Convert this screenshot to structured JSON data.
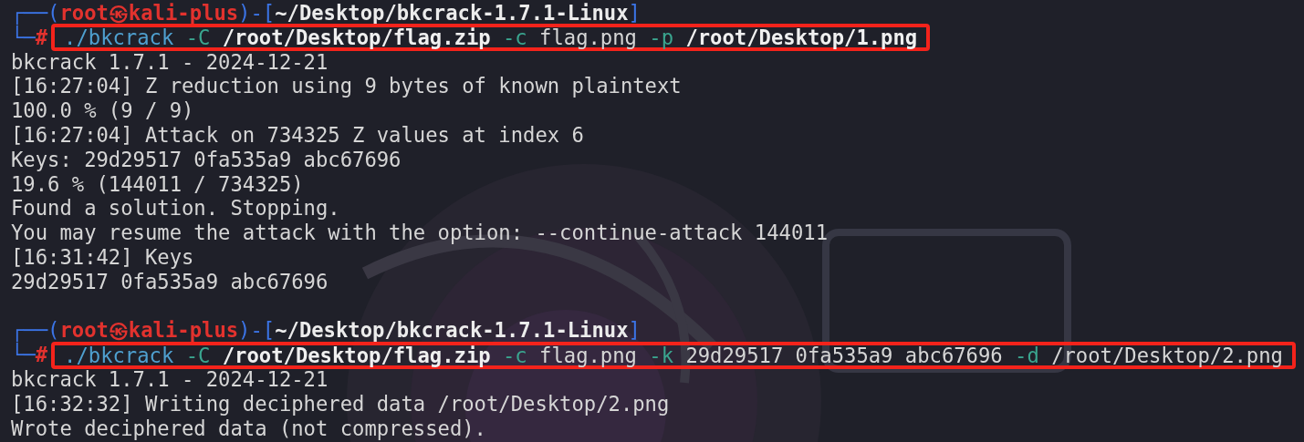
{
  "terminal": {
    "blocks": [
      {
        "prompt": [
          {
            "text": "┌──(",
            "kind": "frame"
          },
          {
            "text": "root㉿kali-plus",
            "kind": "user"
          },
          {
            "text": ")-[",
            "kind": "frame"
          },
          {
            "text": "~/Desktop/bkcrack-1.7.1-Linux",
            "kind": "cwd"
          },
          {
            "text": "]",
            "kind": "frame"
          }
        ],
        "marker": [
          {
            "text": "└─",
            "kind": "frame"
          },
          {
            "text": "#",
            "kind": "hash"
          }
        ],
        "command": {
          "highlighted": true,
          "tokens": [
            {
              "text": "./bkcrack",
              "kind": "program"
            },
            {
              "text": "-C",
              "kind": "flag"
            },
            {
              "text": "/root/Desktop/flag.zip",
              "kind": "path"
            },
            {
              "text": "-c",
              "kind": "flag"
            },
            {
              "text": "flag.png",
              "kind": "arg"
            },
            {
              "text": "-p",
              "kind": "flag"
            },
            {
              "text": "/root/Desktop/1.png",
              "kind": "path"
            }
          ]
        },
        "output": [
          "bkcrack 1.7.1 - 2024-12-21",
          "[16:27:04] Z reduction using 9 bytes of known plaintext",
          "100.0 % (9 / 9)",
          "[16:27:04] Attack on 734325 Z values at index 6",
          "Keys: 29d29517 0fa535a9 abc67696",
          "19.6 % (144011 / 734325)",
          "Found a solution. Stopping.",
          "You may resume the attack with the option: --continue-attack 144011",
          "[16:31:42] Keys",
          "29d29517 0fa535a9 abc67696"
        ]
      },
      {
        "prompt": [
          {
            "text": "┌──(",
            "kind": "frame"
          },
          {
            "text": "root㉿kali-plus",
            "kind": "user"
          },
          {
            "text": ")-[",
            "kind": "frame"
          },
          {
            "text": "~/Desktop/bkcrack-1.7.1-Linux",
            "kind": "cwd"
          },
          {
            "text": "]",
            "kind": "frame"
          }
        ],
        "marker": [
          {
            "text": "└─",
            "kind": "frame"
          },
          {
            "text": "#",
            "kind": "hash"
          }
        ],
        "command": {
          "highlighted": true,
          "tokens": [
            {
              "text": "./bkcrack",
              "kind": "program"
            },
            {
              "text": "-C",
              "kind": "flag"
            },
            {
              "text": "/root/Desktop/flag.zip",
              "kind": "path"
            },
            {
              "text": "-c",
              "kind": "flag"
            },
            {
              "text": "flag.png",
              "kind": "arg"
            },
            {
              "text": "-k",
              "kind": "flag"
            },
            {
              "text": "29d29517 0fa535a9 abc67696",
              "kind": "arg"
            },
            {
              "text": "-d",
              "kind": "flag"
            },
            {
              "text": "/root/Desktop/2.png",
              "kind": "arg"
            }
          ]
        },
        "output": [
          "bkcrack 1.7.1 - 2024-12-21",
          "[16:32:32] Writing deciphered data /root/Desktop/2.png",
          "Wrote deciphered data (not compressed)."
        ]
      }
    ]
  }
}
